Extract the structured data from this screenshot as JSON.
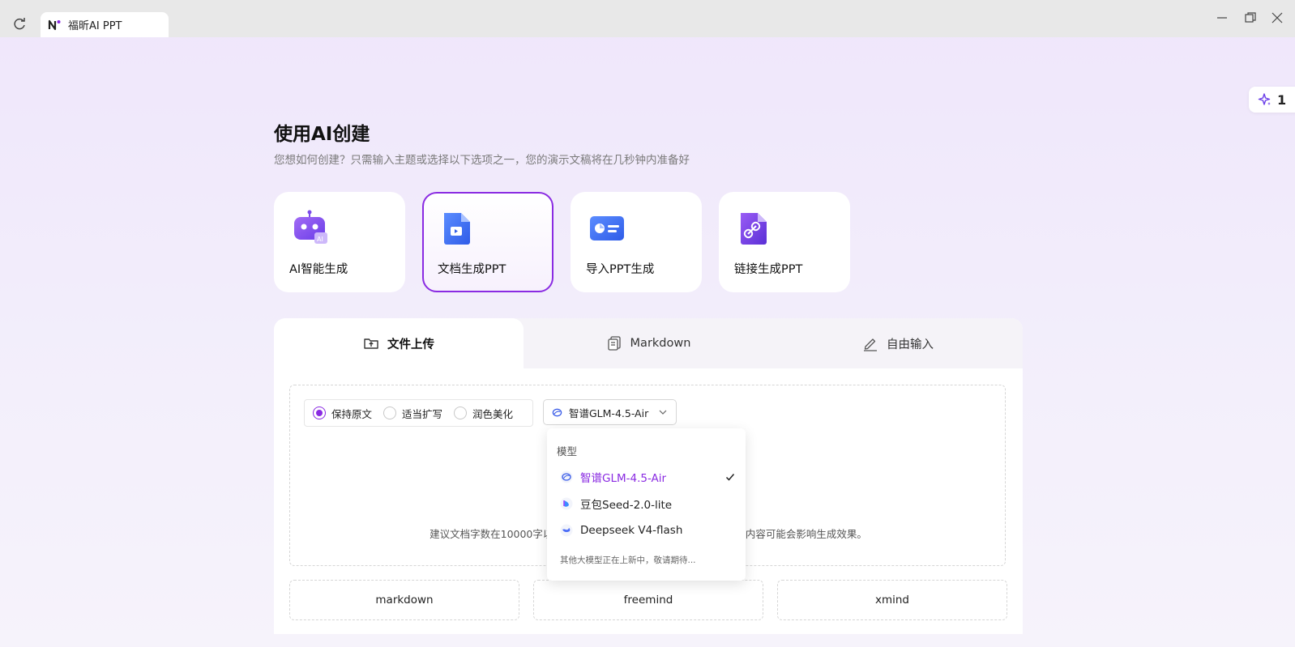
{
  "window": {
    "tab_title": "福昕AI PPT"
  },
  "credits": {
    "count": "1"
  },
  "header": {
    "title": "使用AI创建",
    "subtitle": "您想如何创建？只需输入主题或选择以下选项之一，您的演示文稿将在几秒钟内准备好"
  },
  "modes": [
    {
      "label": "AI智能生成",
      "icon": "robot-icon"
    },
    {
      "label": "文档生成PPT",
      "icon": "document-icon",
      "active": true
    },
    {
      "label": "导入PPT生成",
      "icon": "presentation-icon"
    },
    {
      "label": "链接生成PPT",
      "icon": "link-document-icon"
    }
  ],
  "input_tabs": [
    {
      "label": "文件上传",
      "icon": "folder-upload-icon",
      "active": true
    },
    {
      "label": "Markdown",
      "icon": "copy-document-icon"
    },
    {
      "label": "自由输入",
      "icon": "pen-icon"
    }
  ],
  "options": {
    "radios": [
      {
        "label": "保持原文",
        "checked": true
      },
      {
        "label": "适当扩写",
        "checked": false
      },
      {
        "label": "润色美化",
        "checked": false
      }
    ],
    "model_selected": "智谱GLM-4.5-Air"
  },
  "upload": {
    "hint_left": "建议文档字数在10000字以",
    "hint_right": "体内容可能会影响生成效果。"
  },
  "formats": [
    "markdown",
    "freemind",
    "xmind"
  ],
  "model_dropdown": {
    "header": "模型",
    "items": [
      {
        "label": "智谱GLM-4.5-Air",
        "selected": true
      },
      {
        "label": "豆包Seed-2.0-lite",
        "selected": false
      },
      {
        "label": "Deepseek V4-flash",
        "selected": false
      }
    ],
    "note": "其他大模型正在上新中，敬请期待..."
  },
  "colors": {
    "accent": "#8a2be2"
  }
}
